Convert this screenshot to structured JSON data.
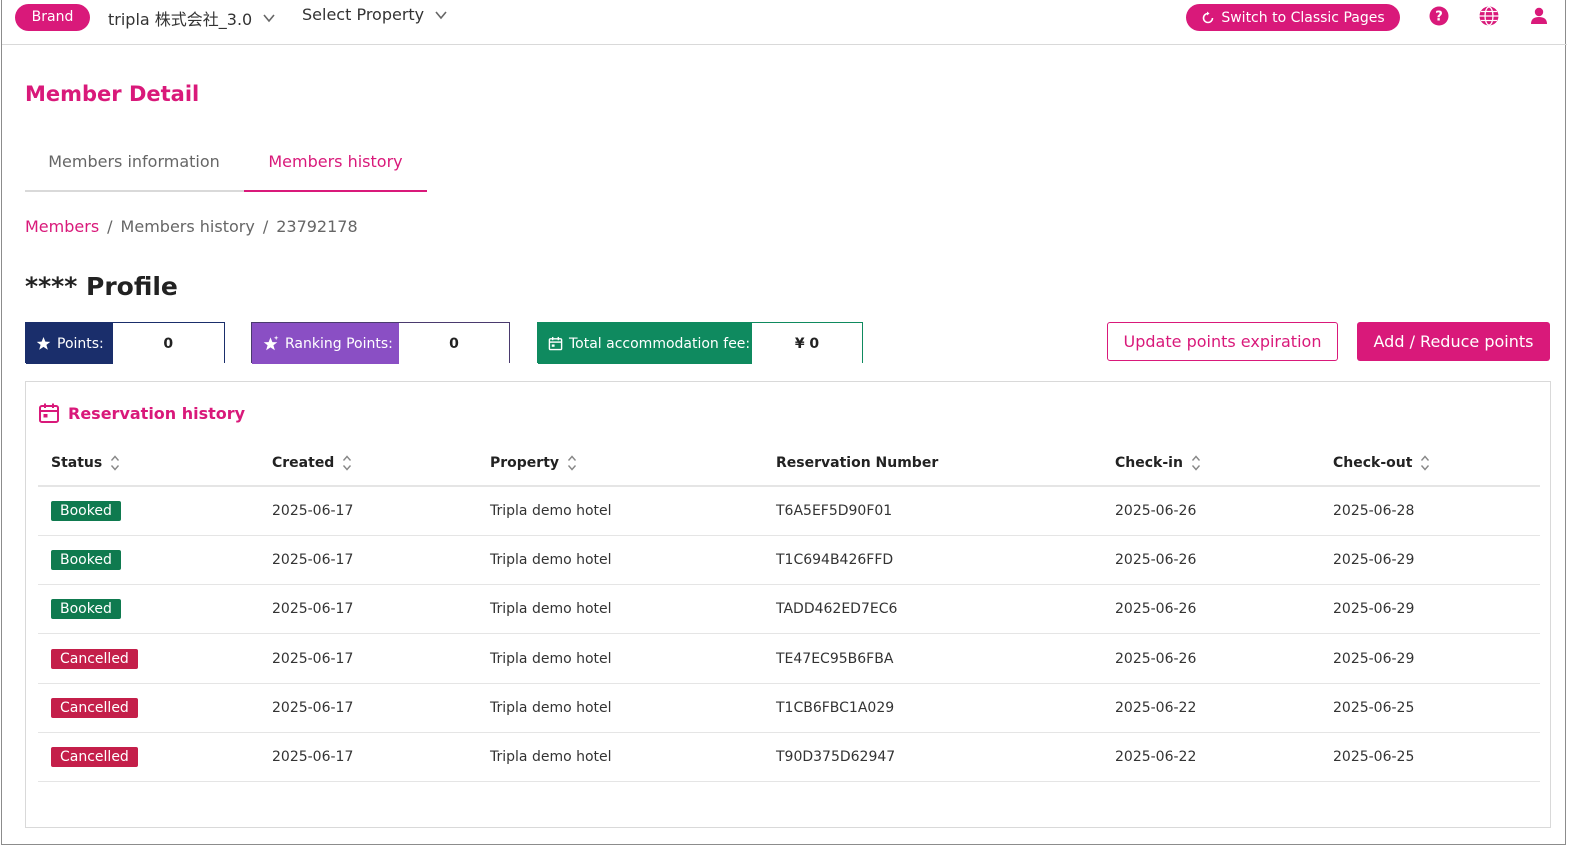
{
  "topbar": {
    "brand_label": "Brand",
    "company": "tripla 株式会社_3.0",
    "property_select": "Select Property",
    "classic_button": "Switch to Classic Pages"
  },
  "page": {
    "title": "Member Detail",
    "tabs": [
      {
        "label": "Members information"
      },
      {
        "label": "Members history"
      }
    ],
    "breadcrumb": [
      "Members",
      "Members history",
      "23792178"
    ],
    "profile_title": "**** Profile"
  },
  "stats": {
    "points_label": "Points:",
    "points_value": "0",
    "ranking_label": "Ranking Points:",
    "ranking_value": "0",
    "fee_label": "Total accommodation fee:",
    "fee_value": "¥ 0"
  },
  "actions": {
    "update_expiration": "Update points expiration",
    "add_reduce": "Add / Reduce points"
  },
  "reservations": {
    "heading": "Reservation history",
    "columns": [
      "Status",
      "Created",
      "Property",
      "Reservation Number",
      "Check-in",
      "Check-out"
    ],
    "rows": [
      {
        "status": "Booked",
        "created": "2025-06-17",
        "property": "Tripla demo hotel",
        "number": "T6A5EF5D90F01",
        "checkin": "2025-06-26",
        "checkout": "2025-06-28"
      },
      {
        "status": "Booked",
        "created": "2025-06-17",
        "property": "Tripla demo hotel",
        "number": "T1C694B426FFD",
        "checkin": "2025-06-26",
        "checkout": "2025-06-29"
      },
      {
        "status": "Booked",
        "created": "2025-06-17",
        "property": "Tripla demo hotel",
        "number": "TADD462ED7EC6",
        "checkin": "2025-06-26",
        "checkout": "2025-06-29"
      },
      {
        "status": "Cancelled",
        "created": "2025-06-17",
        "property": "Tripla demo hotel",
        "number": "TE47EC95B6FBA",
        "checkin": "2025-06-26",
        "checkout": "2025-06-29"
      },
      {
        "status": "Cancelled",
        "created": "2025-06-17",
        "property": "Tripla demo hotel",
        "number": "T1CB6FBC1A029",
        "checkin": "2025-06-22",
        "checkout": "2025-06-25"
      },
      {
        "status": "Cancelled",
        "created": "2025-06-17",
        "property": "Tripla demo hotel",
        "number": "T90D375D62947",
        "checkin": "2025-06-22",
        "checkout": "2025-06-25"
      }
    ]
  },
  "colors": {
    "accent": "#d9197a",
    "booked": "#0f7a4f",
    "cancelled": "#c41f4a",
    "points": "#1a2e6b",
    "ranking": "#8a4fc4",
    "fee": "#0f8a5f"
  },
  "icons": [
    "chevron-down-icon",
    "refresh-icon",
    "help-icon",
    "globe-icon",
    "user-icon",
    "star-icon",
    "sparkle-star-icon",
    "calendar-icon",
    "sort-icon"
  ]
}
